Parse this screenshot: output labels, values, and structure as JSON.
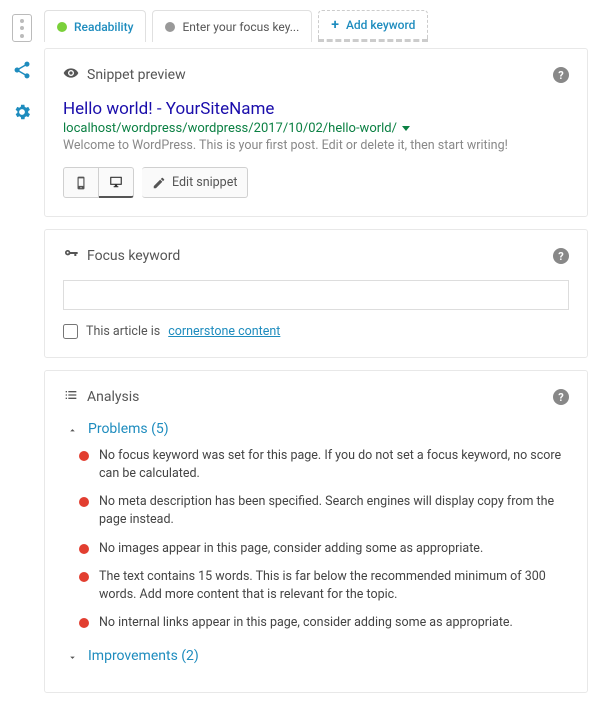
{
  "tabs": {
    "readability": "Readability",
    "focus_placeholder": "Enter your focus key...",
    "add_keyword": "Add keyword"
  },
  "snippet": {
    "header": "Snippet preview",
    "title": "Hello world! - YourSiteName",
    "url": "localhost/wordpress/wordpress/2017/10/02/hello-world/",
    "description": "Welcome to WordPress. This is your first post. Edit or delete it, then start writing!",
    "edit_button": "Edit snippet"
  },
  "focus": {
    "header": "Focus keyword",
    "checkbox_prefix": "This article is",
    "checkbox_link": "cornerstone content"
  },
  "analysis": {
    "header": "Analysis",
    "problems_label": "Problems (5)",
    "improvements_label": "Improvements (2)",
    "problems": [
      "No focus keyword was set for this page. If you do not set a focus keyword, no score can be calculated.",
      "No meta description has been specified. Search engines will display copy from the page instead.",
      "No images appear in this page, consider adding some as appropriate.",
      "The text contains 15 words. This is far below the recommended minimum of 300 words. Add more content that is relevant for the topic.",
      "No internal links appear in this page, consider adding some as appropriate."
    ]
  }
}
